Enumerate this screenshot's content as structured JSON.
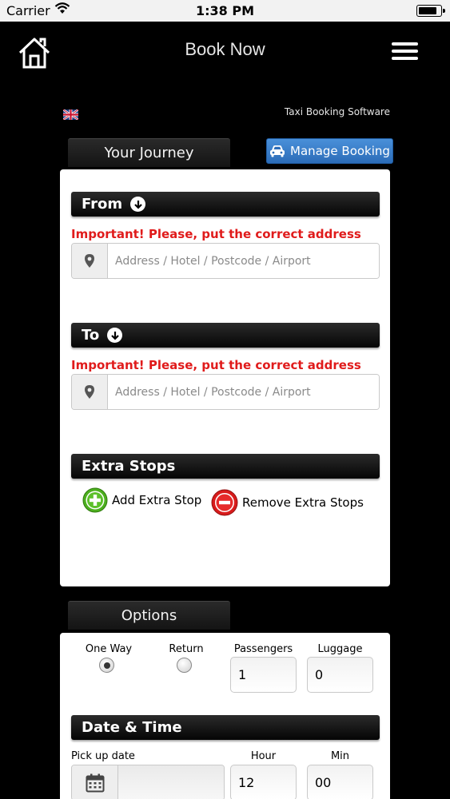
{
  "status_bar": {
    "carrier": "Carrier",
    "time": "1:38 PM"
  },
  "nav": {
    "title": "Book Now",
    "home_icon": "home-icon",
    "menu_icon": "hamburger-menu-icon"
  },
  "brand": "Taxi Booking Software",
  "language_flag": "uk-flag-icon",
  "journey": {
    "tab_label": "Your Journey",
    "manage_booking_label": "Manage Booking",
    "from": {
      "label": "From",
      "warning": "Important! Please, put the correct address",
      "placeholder": "Address / Hotel / Postcode / Airport",
      "value": ""
    },
    "to": {
      "label": "To",
      "warning": "Important! Please, put the correct address",
      "placeholder": "Address / Hotel / Postcode / Airport",
      "value": ""
    },
    "extra_stops": {
      "label": "Extra Stops",
      "add_label": "Add Extra Stop",
      "remove_label": "Remove Extra Stops"
    }
  },
  "options": {
    "tab_label": "Options",
    "one_way_label": "One Way",
    "return_label": "Return",
    "trip_type_selected": "One Way",
    "passengers_label": "Passengers",
    "passengers_value": "1",
    "luggage_label": "Luggage",
    "luggage_value": "0"
  },
  "datetime": {
    "label": "Date & Time",
    "pickup_label": "Pick up date",
    "pickup_value": "",
    "hour_label": "Hour",
    "hour_value": "12",
    "min_label": "Min",
    "min_value": "00"
  },
  "colors": {
    "warning": "#e01b1b",
    "manage_button": "#3a7fcc",
    "add_icon": "#4caf1e",
    "remove_icon": "#d81b1b"
  }
}
